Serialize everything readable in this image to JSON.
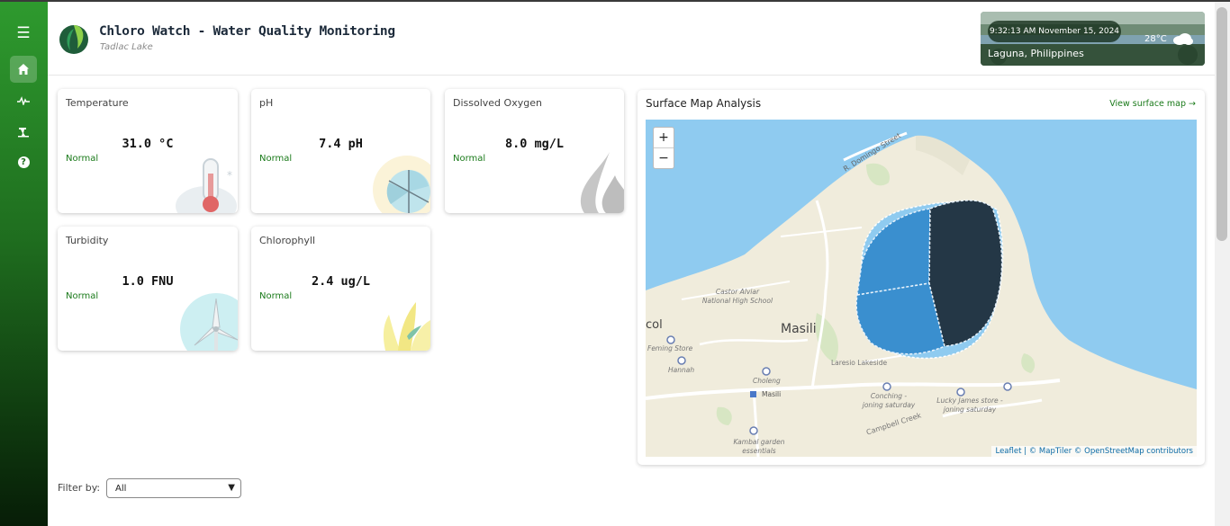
{
  "app": {
    "title": "Chloro Watch - Water Quality Monitoring",
    "subtitle": "Tadlac Lake"
  },
  "sidebar": {
    "items": [
      {
        "name": "menu",
        "icon": "menu-icon",
        "glyph": "☰"
      },
      {
        "name": "home",
        "icon": "home-icon",
        "glyph": "⌂",
        "active": true
      },
      {
        "name": "activity",
        "icon": "activity-icon",
        "glyph": "∿"
      },
      {
        "name": "microscope",
        "icon": "microscope-icon",
        "glyph": "⚗"
      },
      {
        "name": "help",
        "icon": "help-icon",
        "glyph": "?"
      }
    ]
  },
  "weather": {
    "datetime": "9:32:13 AM November 15, 2024",
    "temperature": "28°C",
    "icon": "cloud-icon",
    "location": "Laguna, Philippines"
  },
  "metrics": [
    {
      "label": "Temperature",
      "value": "31.0 °C",
      "status": "Normal",
      "icon": "thermometer-icon"
    },
    {
      "label": "pH",
      "value": "7.4 pH",
      "status": "Normal",
      "icon": "ph-wheel-icon"
    },
    {
      "label": "Dissolved Oxygen",
      "value": "8.0 mg/L",
      "status": "Normal",
      "icon": "water-drop-icon"
    },
    {
      "label": "Turbidity",
      "value": "1.0 FNU",
      "status": "Normal",
      "icon": "turbine-icon"
    },
    {
      "label": "Chlorophyll",
      "value": "2.4 ug/L",
      "status": "Normal",
      "icon": "leaf-icon"
    }
  ],
  "map": {
    "title": "Surface Map Analysis",
    "link": "View surface map →",
    "zoom_in": "+",
    "zoom_out": "−",
    "attribution_leaflet": "Leaflet",
    "attribution_rest": " | © MapTiler © OpenStreetMap contributors",
    "labels": {
      "street1": "R. Domingo Street",
      "school": "Castor Alviar National High School",
      "town": "Masili",
      "col": "col",
      "feming": "Feming Store",
      "hannah": "Hannah",
      "choleng": "Choleng",
      "masili_stop": "Masili",
      "laresio": "Laresio Lakeside",
      "conching": "Conching - joning saturday",
      "lucky": "Lucky James store - joning saturday",
      "campbell": "Campbell Creek",
      "kambal": "Kambal garden essentials"
    }
  },
  "filter": {
    "label": "Filter by:",
    "value": "All"
  },
  "colors": {
    "accent": "#1a7a1a",
    "sidebar_top": "#2e9a2e",
    "sidebar_bottom": "#071d07",
    "water": "#8fcbf0",
    "land": "#f0ecdc",
    "zone_light": "#3a8fcf",
    "zone_dark": "#243746"
  }
}
